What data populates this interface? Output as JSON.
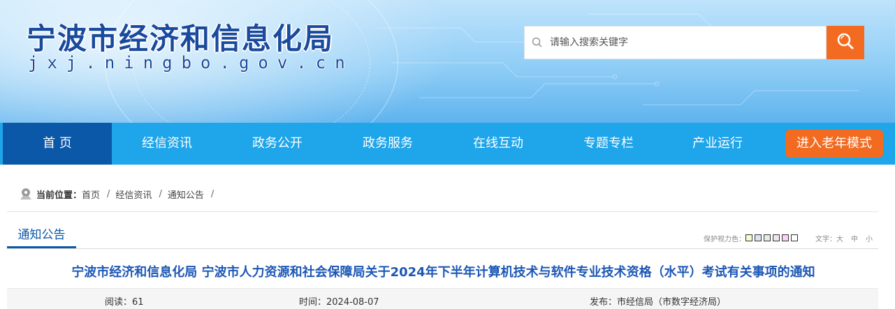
{
  "header": {
    "site_title": "宁波市经济和信息化局",
    "site_domain": "jxj.ningbo.gov.cn",
    "search_placeholder": "请输入搜索关键字"
  },
  "nav": {
    "items": [
      {
        "label": "首 页",
        "active": true
      },
      {
        "label": "经信资讯"
      },
      {
        "label": "政务公开"
      },
      {
        "label": "政务服务"
      },
      {
        "label": "在线互动"
      },
      {
        "label": "专题专栏"
      },
      {
        "label": "产业运行"
      }
    ],
    "elder_mode_label": "进入老年模式"
  },
  "breadcrumb": {
    "prefix": "当前位置：",
    "items": [
      "首页",
      "经信资讯",
      "通知公告"
    ],
    "separator": "/"
  },
  "section": {
    "title": "通知公告"
  },
  "tools": {
    "eye_color_label": "保护视力色：",
    "eye_colors": [
      "#fafad2",
      "#dae5f2",
      "#e3ede3",
      "#f1e6f0",
      "#f7d3f5",
      "#ffffff"
    ],
    "font_label": "文字：",
    "font_sizes": [
      "大",
      "中",
      "小"
    ]
  },
  "article": {
    "title": "宁波市经济和信息化局 宁波市人力资源和社会保障局关于2024年下半年计算机技术与软件专业技术资格（水平）考试有关事项的通知",
    "reads": "阅读：61",
    "time": "时间：2024-08-07",
    "publisher": "发布：市经信局（市数字经济局）"
  },
  "colors": {
    "nav_bg": "#1ea5ea",
    "nav_active": "#0b57a8",
    "accent_orange": "#f36b21",
    "title_blue": "#1c57b5"
  }
}
